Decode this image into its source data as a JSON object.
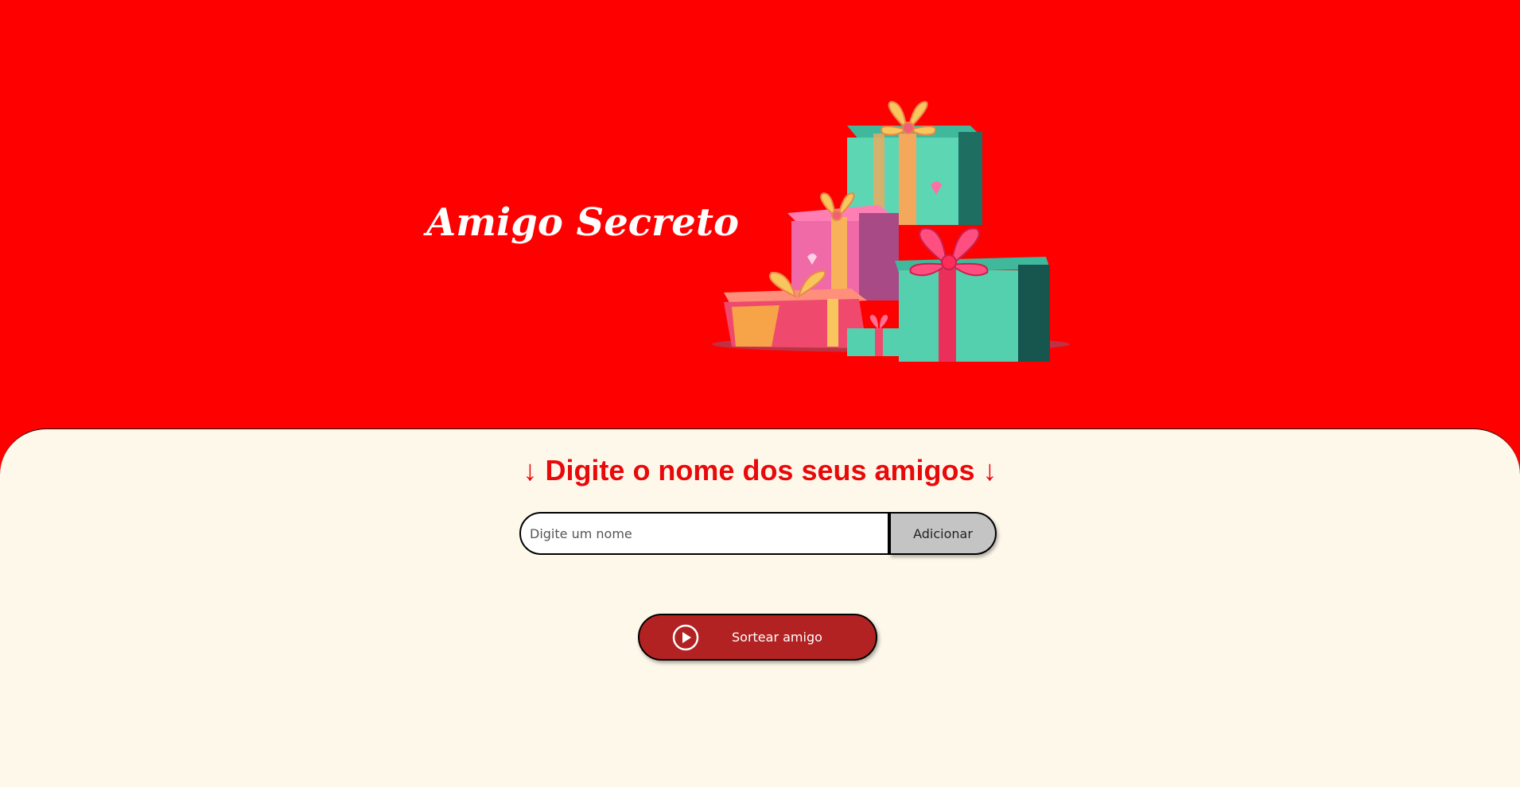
{
  "header": {
    "title": "Amigo Secreto",
    "illustration_icon": "gift-boxes-illustration"
  },
  "main": {
    "section_title": "↓ Digite o nome dos seus amigos ↓",
    "name_input": {
      "value": "",
      "placeholder": "Digite um nome"
    },
    "add_button_label": "Adicionar",
    "draw_button": {
      "label": "Sortear amigo",
      "icon": "play-circle-icon"
    }
  },
  "colors": {
    "header_background": "#ff0000",
    "panel_background": "#fef8ea",
    "title_accent": "#e8090b",
    "draw_button": "#b22222",
    "add_button": "#c4c4c4"
  }
}
